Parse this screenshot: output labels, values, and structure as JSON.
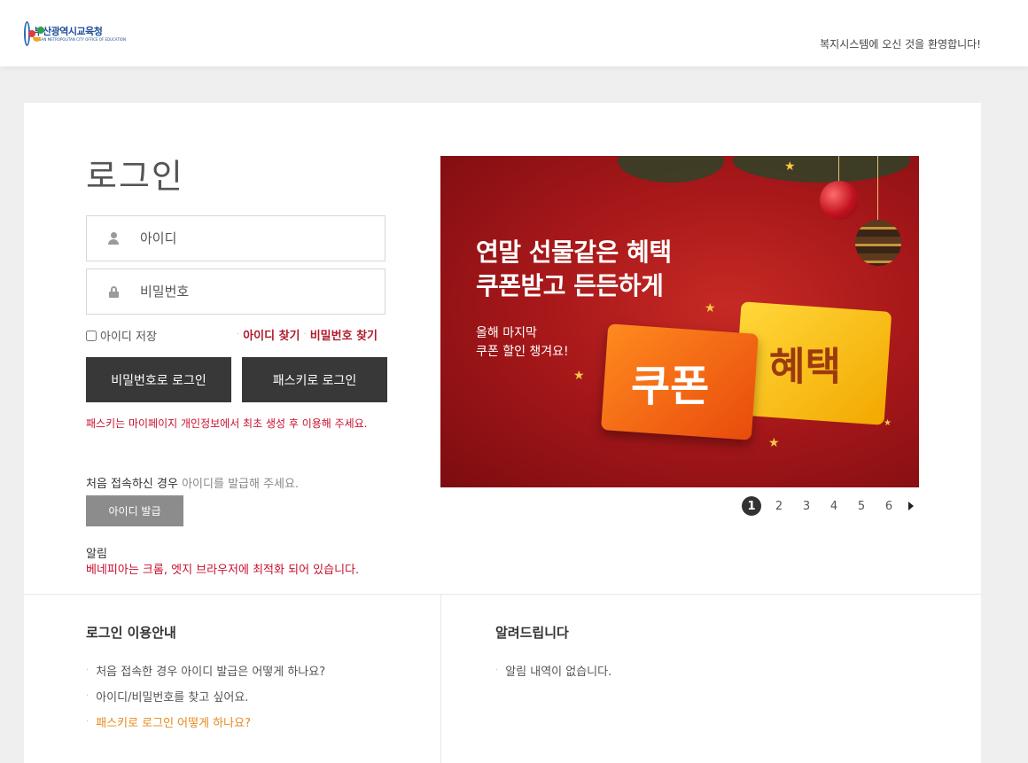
{
  "header": {
    "logo_text": "부산광역시교육청",
    "logo_subtext": "BUSAN METROPOLITAN CITY OFFICE OF EDUCATION",
    "welcome": "복지시스템에 오신 것을 환영합니다!"
  },
  "login": {
    "title": "로그인",
    "id_placeholder": "아이디",
    "pw_placeholder": "비밀번호",
    "remember_label": "아이디 저장",
    "find_id": "아이디 찾기",
    "find_pw": "비밀번호 찾기",
    "btn_password_login": "비밀번호로 로그인",
    "btn_passkey_login": "패스키로 로그인",
    "passkey_note": "패스키는 마이페이지 개인정보에서 최초 생성 후 이용해 주세요.",
    "first_access_text": "처음 접속하신 경우",
    "first_access_hint": "아이디를 발급해 주세요.",
    "btn_issue_id": "아이디 발급",
    "notice_label": "알림",
    "notice_text": "베네피아는 크롬, 엣지 브라우저에 최적화 되어 있습니다."
  },
  "banner": {
    "headline_1": "연말 선물같은 혜택",
    "headline_2": "쿠폰받고 든든하게",
    "sub_1": "올해 마지막",
    "sub_2": "쿠폰 할인 챙겨요!",
    "ticket_front": "쿠폰",
    "ticket_back": "혜택",
    "pages": [
      "1",
      "2",
      "3",
      "4",
      "5",
      "6"
    ],
    "active_page": "1"
  },
  "guide": {
    "title": "로그인 이용안내",
    "items": [
      "처음 접속한 경우 아이디 발급은 어떻게 하나요?",
      "아이디/비밀번호를 찾고 싶어요.",
      "패스키로 로그인 어떻게 하나요?"
    ]
  },
  "notices": {
    "title": "알려드립니다",
    "items": [
      "알림 내역이 없습니다."
    ]
  }
}
